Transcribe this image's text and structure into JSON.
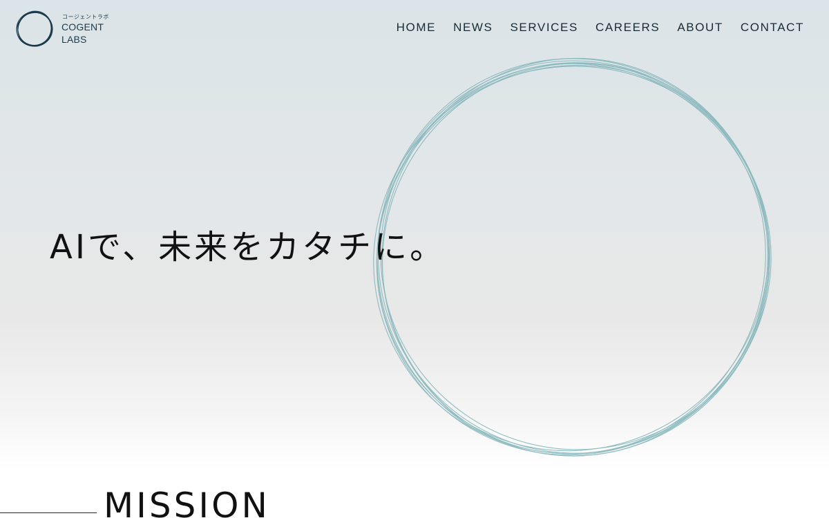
{
  "logo": {
    "kana": "コージェントラボ",
    "line1": "COGENT",
    "line2": "LABS"
  },
  "nav": {
    "items": [
      {
        "label": "HOME"
      },
      {
        "label": "NEWS"
      },
      {
        "label": "SERVICES"
      },
      {
        "label": "CAREERS"
      },
      {
        "label": "ABOUT"
      },
      {
        "label": "CONTACT"
      }
    ]
  },
  "hero": {
    "title": "AIで、未来をカタチに。"
  },
  "mission": {
    "title": "MISSION"
  },
  "colors": {
    "brand": "#1b3a4b",
    "circle_stroke": "#7fb3b8",
    "background_top": "#dbe4e8",
    "background_bottom": "#ffffff"
  },
  "icons": {
    "logo_mark": "scribbled-circle-logo-icon",
    "hero_art": "hand-drawn-circle-art"
  }
}
